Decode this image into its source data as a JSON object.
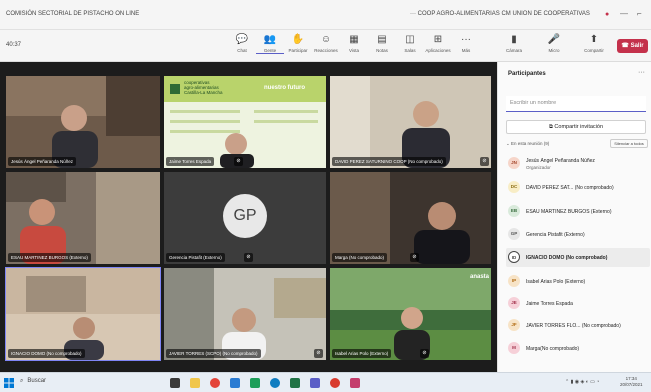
{
  "window": {
    "title_left": "COMISIÓN SECTORIAL DE PISTACHO ON LINE",
    "title_right": "···  COOP AGRO-ALIMENTARIAS CM UNION DE COOPERATIVAS",
    "notification_icon": "dot-icon",
    "min_icon": "minus",
    "close_icon": "x"
  },
  "toolbar": {
    "timer": "40:37",
    "buttons": [
      {
        "icon": "chat-icon",
        "glyph": "💬",
        "label": "Chat"
      },
      {
        "icon": "people-icon",
        "glyph": "👥",
        "label": "Gente"
      },
      {
        "icon": "hand-icon",
        "glyph": "✋",
        "label": "Participar"
      },
      {
        "icon": "reaction-icon",
        "glyph": "☺",
        "label": "Reacciones"
      },
      {
        "icon": "view-icon",
        "glyph": "▦",
        "label": "Vista"
      },
      {
        "icon": "notes-icon",
        "glyph": "▤",
        "label": "Notas"
      },
      {
        "icon": "rooms-icon",
        "glyph": "◫",
        "label": "Salas"
      },
      {
        "icon": "apps-icon",
        "glyph": "⊞",
        "label": "Aplicaciones"
      },
      {
        "icon": "more-icon",
        "glyph": "···",
        "label": "Más"
      },
      {
        "icon": "camera-icon",
        "glyph": "▮",
        "label": "Cámara"
      },
      {
        "icon": "mic-icon",
        "glyph": "🎤",
        "label": "Micro"
      },
      {
        "icon": "share-icon",
        "glyph": "⬆",
        "label": "Compartir"
      }
    ],
    "leave_label": "Salir"
  },
  "tiles": [
    {
      "name": "Jesús Ángel Peñaranda Núñez",
      "muted": false
    },
    {
      "name": "Jaime Torres Espada",
      "muted": true
    },
    {
      "name": "DAVID PEREZ SATURNINO COOP (No comprobado)",
      "muted": true
    },
    {
      "name": "ESAU MARTINEZ BURGOS (Externo)",
      "muted": false
    },
    {
      "name": "Gerencia Pistafit (Externo)",
      "muted": true,
      "initials": "GP"
    },
    {
      "name": "Marga (No comprobado)",
      "muted": true
    },
    {
      "name": "IGNACIO DOMO (No comprobado)",
      "muted": false
    },
    {
      "name": "JAVIER TORRES (SCPO) (No comprobado)",
      "muted": true
    },
    {
      "name": "Isabel Arias Polo (Externo)",
      "muted": true
    }
  ],
  "slide": {
    "brand_line1": "cooperativas",
    "brand_line2": "agro-alimentarias",
    "brand_line3": "Castilla-La Mancha",
    "tagline": "nuestro futuro"
  },
  "tile_bottom_right_brand": "anasta",
  "panel": {
    "title": "Participantes",
    "more": "···",
    "search_placeholder": "Escribir un nombre",
    "share_label": "Compartir invitación",
    "section_label": "En esta reunión (9)",
    "mute_all": "Silenciar a todos",
    "participants": [
      {
        "initials": "JN",
        "name": "Jesús Ángel Peñaranda Núñez",
        "sub": "Organizador",
        "bg": "#f6d5c9",
        "fg": "#a3452a"
      },
      {
        "initials": "DC",
        "name": "DAVID PEREZ SAT... (No comprobado)",
        "sub": "",
        "bg": "#f8edc6",
        "fg": "#8a6b10"
      },
      {
        "initials": "EB",
        "name": "ESAU MARTINEZ BURGOS (Externo)",
        "sub": "",
        "bg": "#d9eadb",
        "fg": "#3b6e40"
      },
      {
        "initials": "GP",
        "name": "Gerencia Pistafit (Externo)",
        "sub": "",
        "bg": "#e6e6e6",
        "fg": "#555555"
      },
      {
        "initials": "ID",
        "name": "IGNACIO DOMO (No comprobado)",
        "sub": "",
        "bg": "#ffffff",
        "fg": "#444444"
      },
      {
        "initials": "IP",
        "name": "Isabel Arias Polo (Externo)",
        "sub": "",
        "bg": "#f7e3c6",
        "fg": "#b06a12"
      },
      {
        "initials": "JE",
        "name": "Jaime Torres Espada",
        "sub": "",
        "bg": "#f6d0d8",
        "fg": "#a3324c"
      },
      {
        "initials": "JF",
        "name": "JAVIER TORRES FLO... (No comprobado)",
        "sub": "",
        "bg": "#f7e3c6",
        "fg": "#b06a12"
      },
      {
        "initials": "M",
        "name": "Marga(No comprobado)",
        "sub": "",
        "bg": "#f6d0d8",
        "fg": "#a3324c"
      }
    ]
  },
  "taskbar": {
    "search_label": "Buscar",
    "clock_time": "17:34",
    "clock_date": "20/07/2021"
  }
}
